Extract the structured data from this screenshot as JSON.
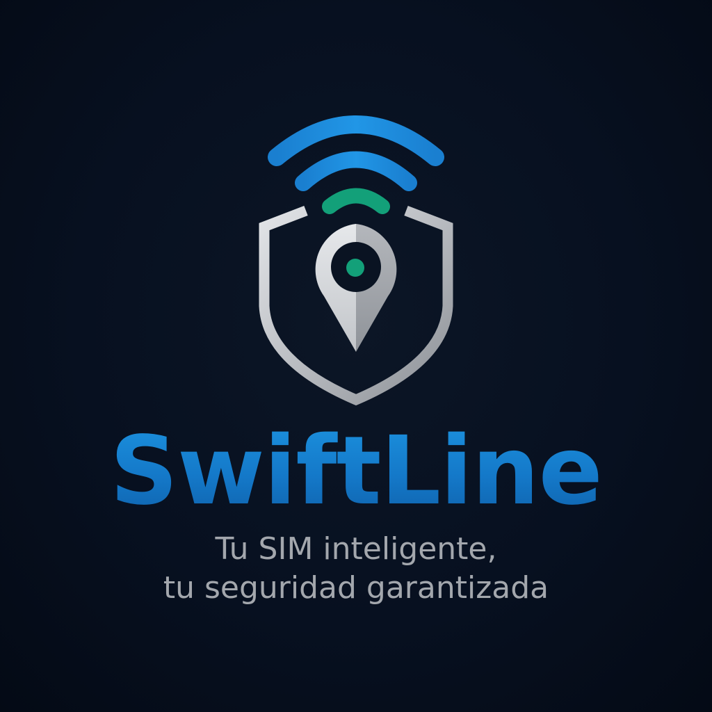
{
  "brand": {
    "name": "SwiftLine",
    "tagline_line1": "Tu SIM inteligente,",
    "tagline_line2": "tu seguridad garantizada"
  },
  "logo": {
    "icons": [
      "wifi-signal-icon",
      "shield-icon",
      "location-pin-icon"
    ]
  },
  "colors": {
    "background": "#071020",
    "brand_blue": "#1478c8",
    "signal_blue": "#1b86d8",
    "signal_green": "#13a079",
    "shield_silver": "#c6c9cd",
    "tagline_gray": "#a3a7ad"
  }
}
